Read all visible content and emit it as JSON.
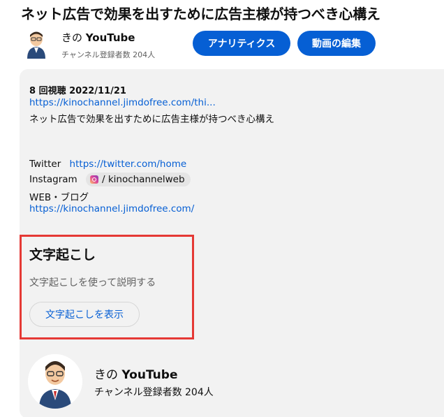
{
  "video": {
    "title": "ネット広告で効果を出すために広告主様が持つべき心構え"
  },
  "owner": {
    "name_prefix": "きの",
    "name_brand": "YouTube",
    "subscribers": "チャンネル登録者数 204人",
    "analytics_button": "アナリティクス",
    "edit_button": "動画の編集"
  },
  "description": {
    "meta": "8 回視聴  2022/11/21",
    "url_short": "https://kinochannel.jimdofree.com/thi...",
    "summary": "ネット広告で効果を出すために広告主様が持つべき心構え",
    "twitter_label": "Twitter",
    "twitter_url": "https://twitter.com/home",
    "instagram_label": "Instagram",
    "instagram_handle": "/ kinochannelweb",
    "blog_label": "WEB・ブログ",
    "blog_url": "https://kinochannel.jimdofree.com/"
  },
  "transcript": {
    "heading": "文字起こし",
    "subtitle": "文字起こしを使って説明する",
    "button": "文字起こしを表示"
  },
  "footer_channel": {
    "name_prefix": "きの",
    "name_brand": "YouTube",
    "subscribers": "チャンネル登録者数 204人"
  },
  "colors": {
    "accent_blue": "#065fd4",
    "highlight_red": "#e53935",
    "panel_gray": "#f2f2f2"
  }
}
